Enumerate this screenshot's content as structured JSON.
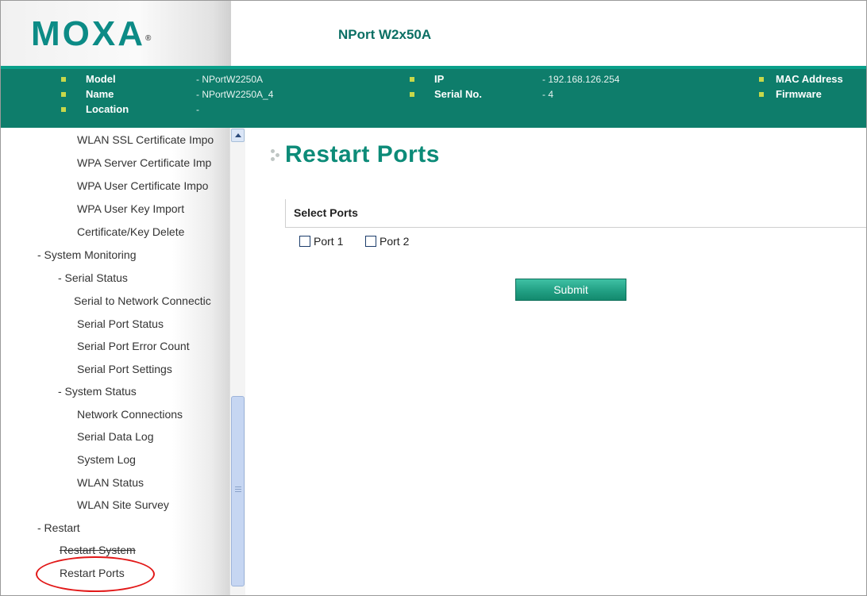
{
  "header": {
    "logo_text": "MOXA",
    "logo_mark": "®",
    "product_name": "NPort W2x50A"
  },
  "infobar": {
    "model_label": "Model",
    "model_value": "- NPortW2250A",
    "name_label": "Name",
    "name_value": "- NPortW2250A_4",
    "location_label": "Location",
    "location_value": "-",
    "ip_label": "IP",
    "ip_value": "- 192.168.126.254",
    "serial_label": "Serial No.",
    "serial_value": "- 4",
    "mac_label": "MAC Address",
    "firmware_label": "Firmware"
  },
  "sidebar": {
    "items": [
      "WLAN SSL Certificate Impo",
      "WPA Server Certificate Imp",
      "WPA User Certificate Impo",
      "WPA User Key Import",
      "Certificate/Key Delete",
      "- System Monitoring",
      "- Serial Status",
      "Serial to Network Connectic",
      "Serial Port Status",
      "Serial Port Error Count",
      "Serial Port Settings",
      "- System Status",
      "Network Connections",
      "Serial Data Log",
      "System Log",
      "WLAN Status",
      "WLAN Site Survey",
      "- Restart",
      "Restart System",
      "Restart Ports"
    ]
  },
  "main": {
    "title": "Restart Ports",
    "section_label": "Select Ports",
    "port1_label": "Port 1",
    "port2_label": "Port 2",
    "submit_label": "Submit"
  },
  "colors": {
    "accent": "#0c8b78",
    "infobar": "#0e7d6b",
    "highlight": "#e21818"
  }
}
